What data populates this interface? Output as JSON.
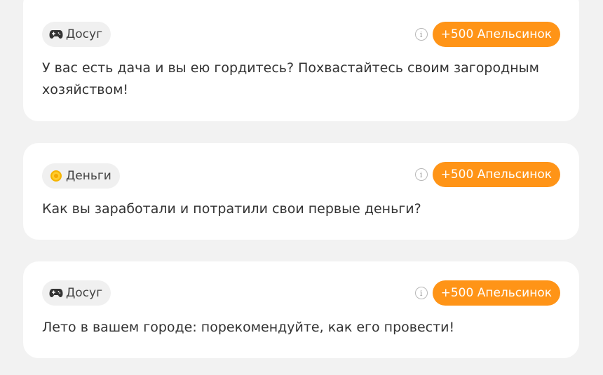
{
  "feed": {
    "cards": [
      {
        "tag_icon": "gamepad-icon",
        "tag_label": "Досуг",
        "reward_label": "+500 Апельсинок",
        "info_icon": "info-icon",
        "question": "У вас есть дача и вы ею гордитесь? Похвастайтесь своим загородным хозяйством!"
      },
      {
        "tag_icon": "coin-icon",
        "tag_label": "Деньги",
        "reward_label": "+500 Апельсинок",
        "info_icon": "info-icon",
        "question": "Как вы заработали и потратили свои первые деньги?"
      },
      {
        "tag_icon": "gamepad-icon",
        "tag_label": "Досуг",
        "reward_label": "+500 Апельсинок",
        "info_icon": "info-icon",
        "question": "Лето в вашем городе: порекомендуйте, как его провести!"
      }
    ]
  },
  "colors": {
    "page_background": "#f2f2f2",
    "card_background": "#ffffff",
    "tag_background": "#f0f0f0",
    "reward_accent": "#ff9417",
    "text": "#333333"
  }
}
